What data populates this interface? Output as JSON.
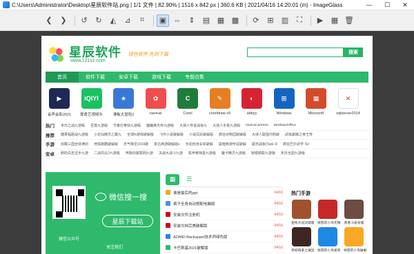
{
  "window": {
    "title": "C:\\Users\\Administrator\\Desktop\\星辰软件站.png  |  1/1 文件  |  82.90%  |  1516 x 842 px  |  360.6 KB  |  2021/04/16 14:20:01 (m)  - ImageGlass",
    "minimize": "—",
    "maximize": "☐",
    "close": "✕"
  },
  "toolbar": {
    "buttons": [
      {
        "name": "prev-icon",
        "glyph": "❮"
      },
      {
        "name": "next-icon",
        "glyph": "❯"
      },
      {
        "name": "rotate-left-icon",
        "glyph": "↺"
      },
      {
        "name": "rotate-right-icon",
        "glyph": "↻"
      },
      {
        "name": "flip-horizontal-icon",
        "glyph": "◭"
      },
      {
        "name": "flip-vertical-icon",
        "glyph": "⊿"
      },
      {
        "name": "crop-icon",
        "glyph": "⌗"
      },
      {
        "name": "zoom-auto-icon",
        "glyph": "▣",
        "active": true
      },
      {
        "name": "zoom-fit-width-icon",
        "glyph": "⇔"
      },
      {
        "name": "zoom-fit-height-icon",
        "glyph": "⇕"
      },
      {
        "name": "zoom-scale-icon",
        "glyph": "▤"
      },
      {
        "name": "zoom-lock-icon",
        "glyph": "▦"
      },
      {
        "name": "scale-to-fill-icon",
        "glyph": "▩"
      },
      {
        "name": "refresh-icon",
        "glyph": "⟳"
      },
      {
        "name": "goto-image-icon",
        "glyph": "⊞"
      },
      {
        "name": "checkerboard-icon",
        "glyph": "▥"
      },
      {
        "name": "fullscreen-icon",
        "glyph": "⛶"
      },
      {
        "name": "slideshow-icon",
        "glyph": "▶"
      },
      {
        "name": "thumbnail-icon",
        "glyph": "▦"
      },
      {
        "name": "delete-icon",
        "glyph": "🗑"
      }
    ]
  },
  "site": {
    "logo_name": "星辰软件",
    "logo_url": "www.121xz.com",
    "slogan": "绿色软件 先到下载",
    "search_button": "搜索",
    "nav": [
      "首页",
      "软件下载",
      "安卓下载",
      "游戏下载",
      "专题合集"
    ],
    "apps": [
      {
        "label": "会声会影2021",
        "color": "#1e2a55",
        "glyph": "▶"
      },
      {
        "label": "爱奇艺视频头",
        "color": "#19c15f",
        "glyph": "iQIYI"
      },
      {
        "label": "滑板大冒险2",
        "color": "#3b78d6",
        "glyph": "★"
      },
      {
        "label": "navicat",
        "color": "#f04e4e",
        "glyph": "✿"
      },
      {
        "label": "Corel",
        "color": "#1f7d3c",
        "glyph": "C"
      },
      {
        "label": "coreldraw x9",
        "color": "#e67e22",
        "glyph": "✎"
      },
      {
        "label": "abbyy",
        "color": "#d62333",
        "glyph": "◐"
      },
      {
        "label": "Windows",
        "color": "#1565c0",
        "glyph": "⊞"
      },
      {
        "label": "Microsoft",
        "color": "#d34b2a",
        "glyph": "▦"
      },
      {
        "label": "sqlserver2014",
        "color": "#ffffff",
        "glyph": "✕"
      }
    ],
    "categories": [
      {
        "title": "热门",
        "links": [
          "末日之战九游版",
          "至尊九游版",
          "节奏打带快九游版",
          "魔魔英杰传九游版",
          "大侠人传说战争九",
          "大侠人手俊九游版",
          "navicat premiu",
          "windows/office"
        ]
      },
      {
        "title": "推荐",
        "links": [
          "糖果幅砸战九游版",
          "小花仙精灵之翼九",
          "全球fx游戏破解版",
          "飞中小说破解版",
          "小说闯关破解版",
          "疯狂动物园破解版",
          "大侠人联盟内购破",
          "武炼巅峰之帝王传"
        ]
      },
      {
        "title": "手游",
        "links": [
          "双截三国全体神旧",
          "地铁跑酷破解版",
          "天气降至2019破",
          "复古西游破解版v",
          "手动自身车体破解",
          "黑暗西游传说破解",
          "驱范战争(Tank R",
          "疯狂巴尔武学 Ter"
        ]
      },
      {
        "title": "安卓",
        "links": [
          "刷奶白吉宝手九游",
          "二战风云2九游版",
          "奔跑剑客联网九游",
          "决战大战斗九游",
          "机甲奥特曼九游版",
          "魔卡精灵九游版",
          "锁银镜联九游版",
          "末日全副九游版"
        ]
      }
    ],
    "wechat": {
      "title": "微信搜一搜",
      "pill": "星辰下载站",
      "qr_caption": "微信公众号",
      "follow": "关注我们"
    },
    "news": {
      "tabs": [
        "▦",
        "☰"
      ],
      "rows": [
        {
          "title": "谁是最后的ppt",
          "date": "04/16",
          "color": "#f5a623"
        },
        {
          "title": "裤子全身自动搭配电脑版",
          "date": "04/16",
          "color": "#4a90e2"
        },
        {
          "title": "安装文件注册机",
          "date": "04/16",
          "color": "#d0021b"
        },
        {
          "title": "安装文档完美破解版",
          "date": "04/16",
          "color": "#d0021b"
        },
        {
          "title": "AOMEI Backupper技术师绿色版",
          "date": "04/16",
          "color": "#2f80ed"
        },
        {
          "title": "卡巴斯基2021破解版",
          "date": "04/16",
          "color": "#2fb96c"
        }
      ]
    },
    "games": {
      "title": "热门手游",
      "items": [
        {
          "label": "金钱大战双城版",
          "color": "#a0522d"
        },
        {
          "label": "愤怒的小鸟无限",
          "color": "#c62828"
        },
        {
          "label": "勇者斗恶龙版",
          "color": "#6d4c41"
        },
        {
          "label": "突如奇来土拨鼠",
          "color": "#3e2723"
        },
        {
          "label": "愤怒的小鸟星际",
          "color": "#1e88e5"
        },
        {
          "label": "愤怒的小鸟破解",
          "color": "#f9a825"
        }
      ]
    }
  }
}
